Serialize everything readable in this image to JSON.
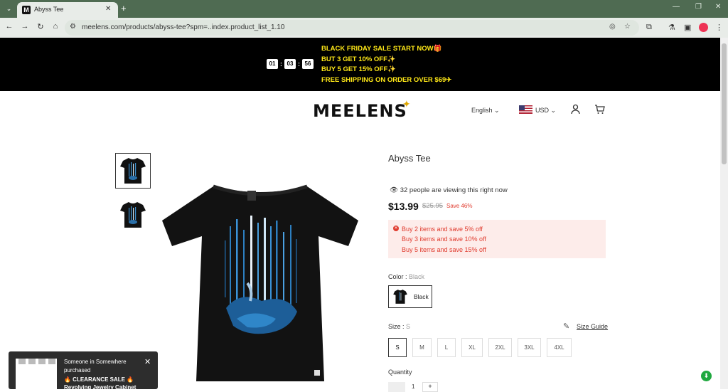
{
  "browser": {
    "tab_title": "Abyss Tee",
    "tab_favicon": "M",
    "new_tab": "+",
    "url": "meelens.com/products/abyss-tee?spm=..index.product_list_1.10"
  },
  "promo": {
    "countdown": [
      "01",
      "03",
      "56"
    ],
    "lines": [
      "BLACK FRIDAY SALE START NOW🎁",
      "BUT 3 GET 10% OFF✨",
      "BUY 5 GET 15% OFF✨",
      "FREE SHIPPING ON ORDER OVER $69✈"
    ],
    "text_color": "#ffe817"
  },
  "header": {
    "logo": "MEELENS",
    "language": "English",
    "currency": "USD",
    "icons": [
      "chevron-down-icon",
      "user-icon",
      "cart-icon"
    ]
  },
  "product": {
    "title": "Abyss Tee",
    "viewing": "32 people are viewing this right now",
    "price": "$13.99",
    "compare_price": "$25.95",
    "save": "Save 46%",
    "offers": [
      "Buy 2 items and save 5% off",
      "Buy 3 items and save 10% off",
      "Buy 5 items and save 15% off"
    ],
    "color_label": "Color",
    "color_value": "Black",
    "color_option": "Black",
    "size_label": "Size",
    "size_value": "S",
    "size_guide": "Size Guide",
    "sizes": [
      "S",
      "M",
      "L",
      "XL",
      "2XL",
      "3XL",
      "4XL"
    ],
    "quantity_label": "Quantity",
    "quantity": "1",
    "accent_color": "#e03c2f"
  },
  "popup": {
    "line1": "Someone in Somewhere",
    "line2": "purchased",
    "line3": "🔥 CLEARANCE SALE 🔥",
    "line4": "Revolving Jewelry Cabinet"
  }
}
